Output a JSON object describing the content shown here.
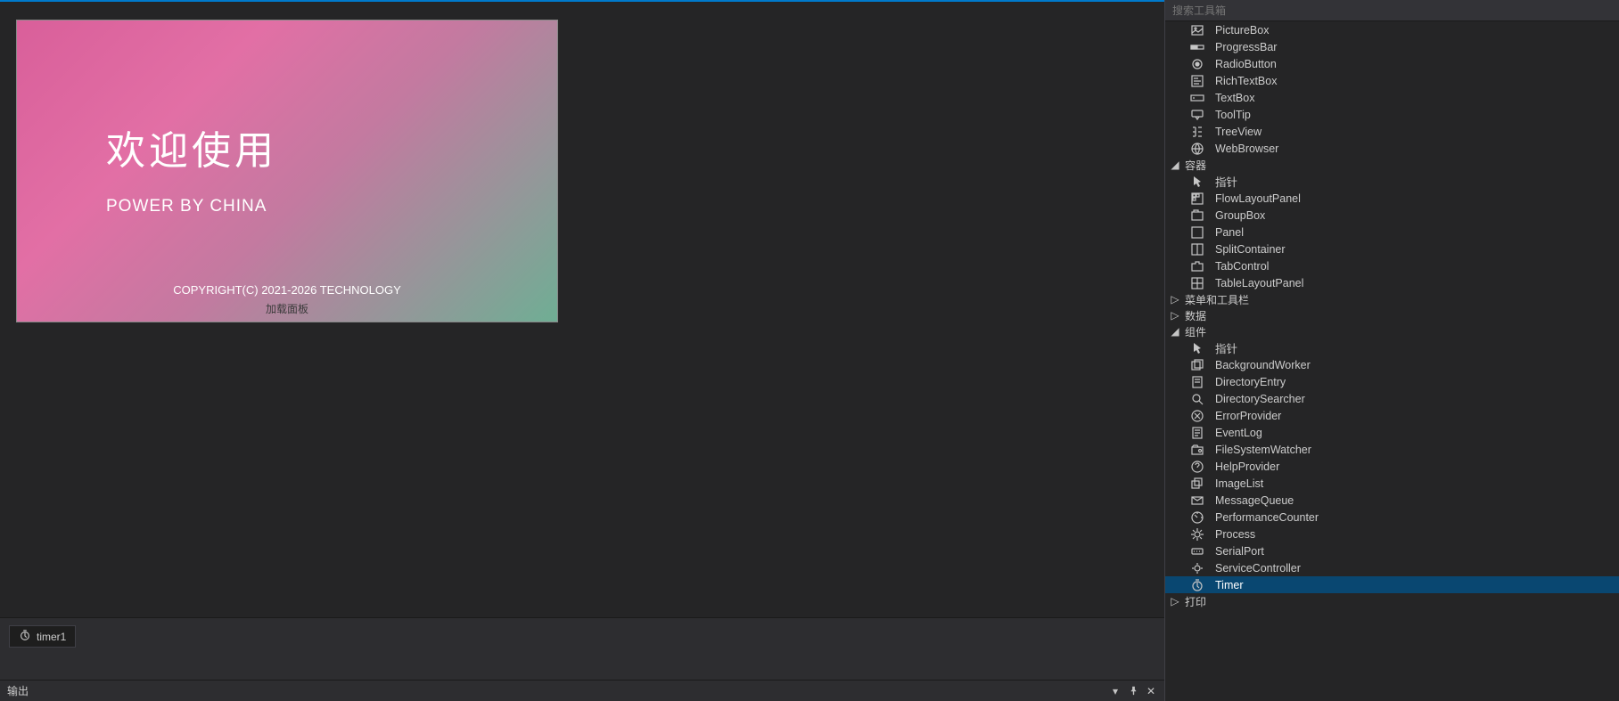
{
  "splash": {
    "title": "欢迎使用",
    "subtitle": "POWER BY CHINA",
    "copyright": "COPYRIGHT(C) 2021-2026 TECHNOLOGY",
    "panel_label": "加载面板"
  },
  "tray": {
    "timer_label": "timer1"
  },
  "output": {
    "title": "输出"
  },
  "toolbox": {
    "search_placeholder": "搜索工具箱",
    "items_common": [
      {
        "label": "PictureBox",
        "icon": "picturebox"
      },
      {
        "label": "ProgressBar",
        "icon": "progressbar"
      },
      {
        "label": "RadioButton",
        "icon": "radiobutton"
      },
      {
        "label": "RichTextBox",
        "icon": "richtextbox"
      },
      {
        "label": "TextBox",
        "icon": "textbox"
      },
      {
        "label": "ToolTip",
        "icon": "tooltip"
      },
      {
        "label": "TreeView",
        "icon": "treeview"
      },
      {
        "label": "WebBrowser",
        "icon": "webbrowser"
      }
    ],
    "cat_containers": {
      "label": "容器",
      "expanded": true
    },
    "items_containers": [
      {
        "label": "指针",
        "icon": "pointer"
      },
      {
        "label": "FlowLayoutPanel",
        "icon": "flowlayout"
      },
      {
        "label": "GroupBox",
        "icon": "groupbox"
      },
      {
        "label": "Panel",
        "icon": "panel"
      },
      {
        "label": "SplitContainer",
        "icon": "splitcontainer"
      },
      {
        "label": "TabControl",
        "icon": "tabcontrol"
      },
      {
        "label": "TableLayoutPanel",
        "icon": "tablelayout"
      }
    ],
    "cat_menus": {
      "label": "菜单和工具栏",
      "expanded": false
    },
    "cat_data": {
      "label": "数据",
      "expanded": false
    },
    "cat_components": {
      "label": "组件",
      "expanded": true
    },
    "items_components": [
      {
        "label": "指针",
        "icon": "pointer"
      },
      {
        "label": "BackgroundWorker",
        "icon": "bgworker"
      },
      {
        "label": "DirectoryEntry",
        "icon": "direntry"
      },
      {
        "label": "DirectorySearcher",
        "icon": "dirsearch"
      },
      {
        "label": "ErrorProvider",
        "icon": "errorprovider"
      },
      {
        "label": "EventLog",
        "icon": "eventlog"
      },
      {
        "label": "FileSystemWatcher",
        "icon": "fswatcher"
      },
      {
        "label": "HelpProvider",
        "icon": "helpprovider"
      },
      {
        "label": "ImageList",
        "icon": "imagelist"
      },
      {
        "label": "MessageQueue",
        "icon": "messagequeue"
      },
      {
        "label": "PerformanceCounter",
        "icon": "perfcounter"
      },
      {
        "label": "Process",
        "icon": "process"
      },
      {
        "label": "SerialPort",
        "icon": "serialport"
      },
      {
        "label": "ServiceController",
        "icon": "service"
      },
      {
        "label": "Timer",
        "icon": "timer",
        "selected": true
      }
    ],
    "cat_print": {
      "label": "打印",
      "expanded": false
    }
  }
}
